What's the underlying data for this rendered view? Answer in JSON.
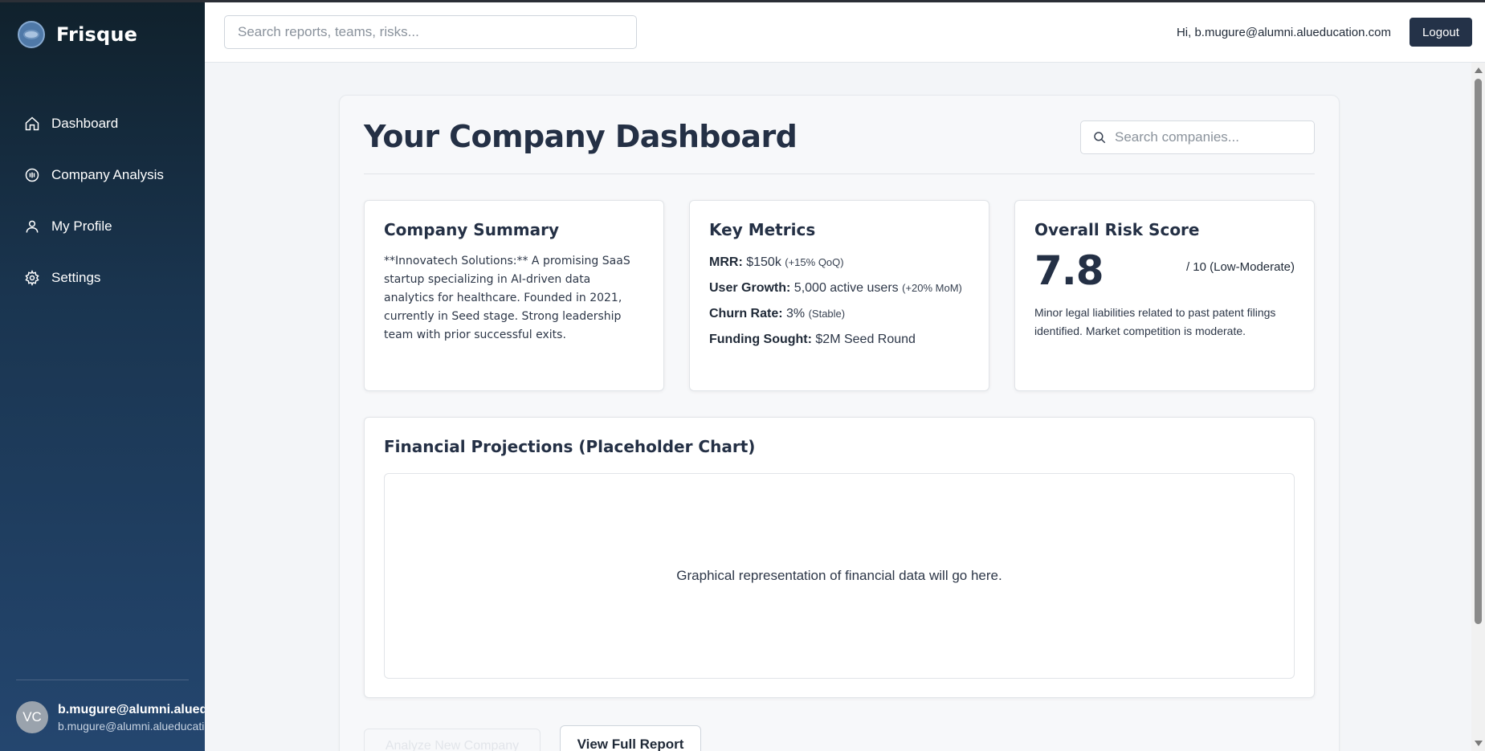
{
  "app": {
    "name": "Frisque"
  },
  "sidebar": {
    "items": [
      {
        "label": "Dashboard",
        "icon": "home-icon"
      },
      {
        "label": "Company Analysis",
        "icon": "analysis-icon"
      },
      {
        "label": "My Profile",
        "icon": "user-icon"
      },
      {
        "label": "Settings",
        "icon": "gear-icon"
      }
    ],
    "user": {
      "initials": "VC",
      "name": "b.mugure@alumni.alueducation.com",
      "email": "b.mugure@alumni.alueducation.com"
    }
  },
  "topbar": {
    "search_placeholder": "Search reports, teams, risks...",
    "greeting": "Hi, b.mugure@alumni.alueducation.com",
    "logout_label": "Logout"
  },
  "main": {
    "title": "Your Company Dashboard",
    "company_search_placeholder": "Search companies...",
    "summary": {
      "title": "Company Summary",
      "text": "**Innovatech Solutions:** A promising SaaS startup specializing in AI-driven data analytics for healthcare. Founded in 2021, currently in Seed stage. Strong leadership team with prior successful exits."
    },
    "metrics": {
      "title": "Key Metrics",
      "mrr_label": "MRR:",
      "mrr_value": "$150k",
      "mrr_note": "(+15% QoQ)",
      "growth_label": "User Growth:",
      "growth_value": "5,000 active users",
      "growth_note": "(+20% MoM)",
      "churn_label": "Churn Rate:",
      "churn_value": "3%",
      "churn_note": "(Stable)",
      "funding_label": "Funding Sought:",
      "funding_value": "$2M Seed Round"
    },
    "risk": {
      "title": "Overall Risk Score",
      "score": "7.8",
      "scale": "/ 10 (Low-Moderate)",
      "note": "Minor legal liabilities related to past patent filings identified. Market competition is moderate."
    },
    "chart": {
      "title": "Financial Projections (Placeholder Chart)",
      "placeholder": "Graphical representation of financial data will go here."
    },
    "actions": {
      "analyze_label": "Analyze New Company",
      "full_report_label": "View Full Report"
    }
  },
  "colors": {
    "sidebar_top": "#10212c",
    "sidebar_bottom": "#24466f",
    "primary_button": "#243248",
    "heading": "#243045"
  }
}
